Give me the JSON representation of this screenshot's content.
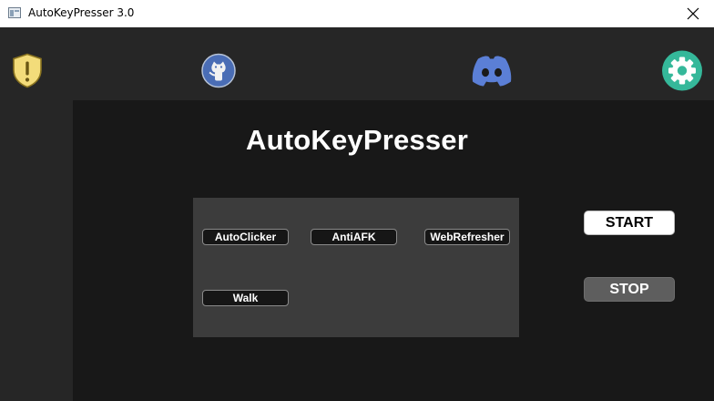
{
  "window": {
    "title": "AutoKeyPresser 3.0"
  },
  "toolbar": {
    "icons": [
      "warning-shield-icon",
      "github-icon",
      "discord-icon",
      "settings-gear-icon"
    ]
  },
  "main": {
    "heading": "AutoKeyPresser",
    "modes": [
      {
        "label": "AutoClicker"
      },
      {
        "label": "AntiAFK"
      },
      {
        "label": "WebRefresher"
      },
      {
        "label": "Walk"
      }
    ],
    "start_label": "START",
    "stop_label": "STOP"
  },
  "colors": {
    "background": "#262626",
    "panel": "#181818",
    "mode_panel": "#3c3c3c",
    "shield": "#f3dc7a",
    "discord": "#5b7fd6",
    "settings": "#35b89a",
    "github": "#4a6db5"
  }
}
